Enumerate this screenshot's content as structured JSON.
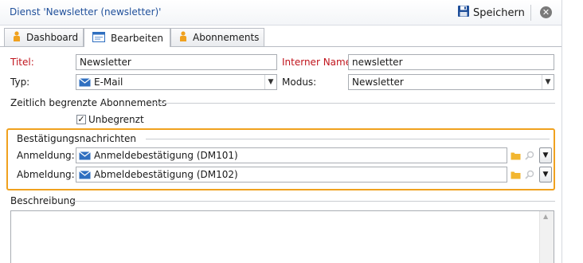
{
  "window": {
    "title": "Dienst 'Newsletter (newsletter)'",
    "save_label": "Speichern",
    "close_glyph": "✕"
  },
  "tabs": [
    {
      "label": "Dashboard",
      "icon": "person-icon"
    },
    {
      "label": "Bearbeiten",
      "icon": "form-window-icon",
      "active": true
    },
    {
      "label": "Abonnements",
      "icon": "person-icon"
    }
  ],
  "form": {
    "title_label": "Titel:",
    "title_value": "Newsletter",
    "internal_name_label": "Interner Name:",
    "internal_name_value": "newsletter",
    "type_label": "Typ:",
    "type_value": "E-Mail",
    "mode_label": "Modus:",
    "mode_value": "Newsletter"
  },
  "limited_subscriptions": {
    "header": "Zeitlich begrenzte Abonnements",
    "unlimited_label": "Unbegrenzt",
    "unlimited_checked": true,
    "check_glyph": "✓"
  },
  "confirmations": {
    "header": "Bestätigungsnachrichten",
    "signup_label": "Anmeldung:",
    "signup_value": "Anmeldebestätigung (DM101)",
    "signoff_label": "Abmeldung:",
    "signoff_value": "Abmeldebestätigung (DM102)"
  },
  "description": {
    "header": "Beschreibung"
  },
  "colors": {
    "title_blue": "#1f4f9a",
    "required_red": "#c0141c",
    "highlight_orange": "#f0a11e",
    "person_orange": "#f0a11e",
    "mail_blue": "#2f6fc0",
    "folder_yellow": "#f2b630"
  }
}
